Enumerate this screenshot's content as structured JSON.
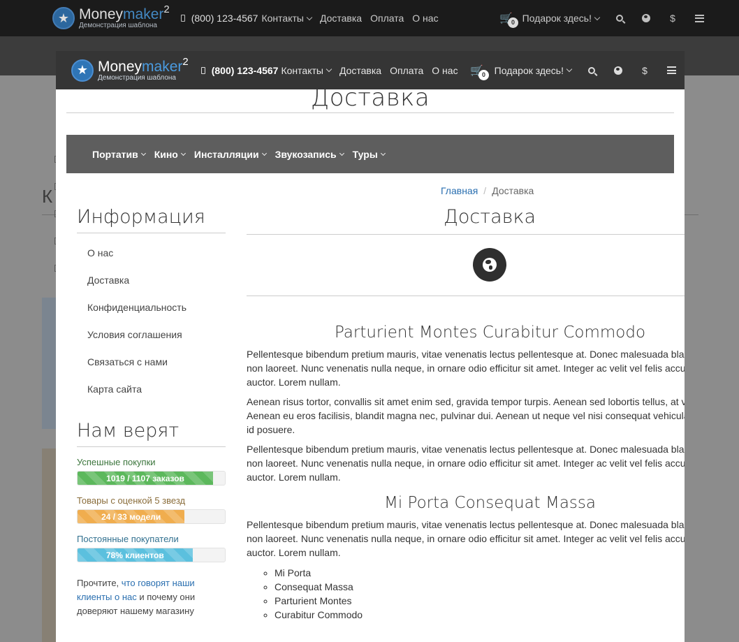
{
  "header": {
    "logo_main": "Money",
    "logo_accent": "maker",
    "logo_sup": "2",
    "logo_sub": "Демонстрация шаблона",
    "phone": "(800) 123-4567",
    "nav": [
      "Контакты",
      "Доставка",
      "Оплата",
      "О нас"
    ],
    "cart_count": "0",
    "gift": "Подарок здесь!",
    "currency_symbol": "$"
  },
  "modal": {
    "page_title": "Доставка",
    "categories": [
      "Портатив",
      "Кино",
      "Инсталляции",
      "Звукозапись",
      "Туры"
    ],
    "breadcrumb": {
      "home": "Главная",
      "current": "Доставка"
    },
    "sidebar": {
      "info_title": "Информация",
      "info_links": [
        "О нас",
        "Доставка",
        "Конфиденциальность",
        "Условия соглашения",
        "Связаться с нами",
        "Карта сайта"
      ],
      "trust_title": "Нам верят",
      "bars": [
        {
          "label": "Успешные покупки",
          "text": "1019 / 1107 заказов",
          "percent": 92,
          "color": "#5cb85c",
          "label_color": "#3c763d"
        },
        {
          "label": "Товары с оценкой 5 звезд",
          "text": "24 / 33 модели",
          "percent": 72.7,
          "color": "#f0ad4e",
          "label_color": "#8a6d3b"
        },
        {
          "label": "Постоянные покупатели",
          "text": "78% клиентов",
          "percent": 78,
          "color": "#5bc0de",
          "label_color": "#31708f"
        }
      ],
      "note_prefix": "Прочтите, ",
      "note_link": "что говорят наши клиенты о нас",
      "note_suffix": " и почему они доверяют нашему магазину"
    },
    "main": {
      "title": "Доставка",
      "h1": "Parturient Montes Curabitur Commodo",
      "p1": "Pellentesque bibendum pretium mauris, vitae venenatis lectus pellentesque at. Donec malesuada blandit nibh non laoreet. Nunc venenatis nulla neque, in ornare odio efficitur sit amet. Integer ac velit vel felis accumsan auctor. Lorem nullam.",
      "p2": "Aenean risus tortor, convallis sit amet enim sed, gravida tempor turpis. Aenean sed lobortis tellus, at varius eros. Aenean eu eros facilisis, blandit magna nec, pulvinar dui. Aenean ut neque vel nisi consequat vehicula molestie id posuere.",
      "p3": "Pellentesque bibendum pretium mauris, vitae venenatis lectus pellentesque at. Donec malesuada blandit nibh non laoreet. Nunc venenatis nulla neque, in ornare odio efficitur sit amet. Integer ac velit vel felis accumsan auctor. Lorem nullam.",
      "h2": "Mi Porta Consequat Massa",
      "p4": "Pellentesque bibendum pretium mauris, vitae venenatis lectus pellentesque at. Donec malesuada blandit nibh non laoreet. Nunc venenatis nulla neque, in ornare odio efficitur sit amet. Integer ac velit vel felis accumsan auctor. Lorem nullam.",
      "list": [
        "Mi Porta",
        "Consequat Massa",
        "Parturient Montes",
        "Curabitur Commodo"
      ]
    }
  }
}
